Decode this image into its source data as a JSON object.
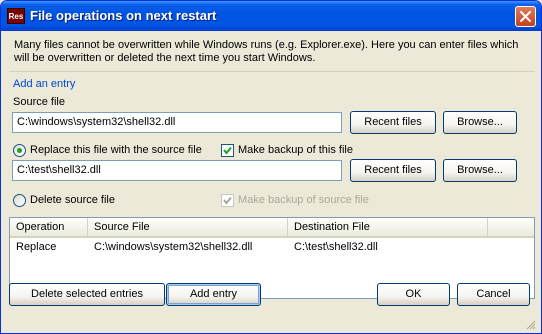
{
  "window": {
    "title": "File operations on next restart",
    "app_icon_text": "Res"
  },
  "intro_text": "Many files cannot be overwritten while Windows runs (e.g. Explorer.exe). Here you can enter files which will be overwritten or deleted the next time you start Windows.",
  "add_entry": {
    "group_label": "Add an entry",
    "source_label": "Source file",
    "source_value": "C:\\windows\\system32\\shell32.dll",
    "recent_files_label": "Recent files",
    "browse_label": "Browse...",
    "replace_radio_label": "Replace this file with the source file",
    "replace_selected": true,
    "make_backup_label": "Make backup of this file",
    "make_backup_checked": true,
    "dest_value": "C:\\test\\shell32.dll",
    "delete_radio_label": "Delete source file",
    "delete_selected": false,
    "make_backup_source_label": "Make backup of source file",
    "make_backup_source_checked": true
  },
  "list": {
    "columns": [
      "Operation",
      "Source File",
      "Destination File"
    ],
    "rows": [
      [
        "Replace",
        "C:\\windows\\system32\\shell32.dll",
        "C:\\test\\shell32.dll"
      ]
    ]
  },
  "buttons": {
    "delete_selected": "Delete selected entries",
    "add_entry": "Add entry",
    "ok": "OK",
    "cancel": "Cancel"
  },
  "colors": {
    "titlebar": "#0054E3",
    "group_label": "#0046D5",
    "radio_dot": "#21A121",
    "close_button": "#C4401E"
  }
}
